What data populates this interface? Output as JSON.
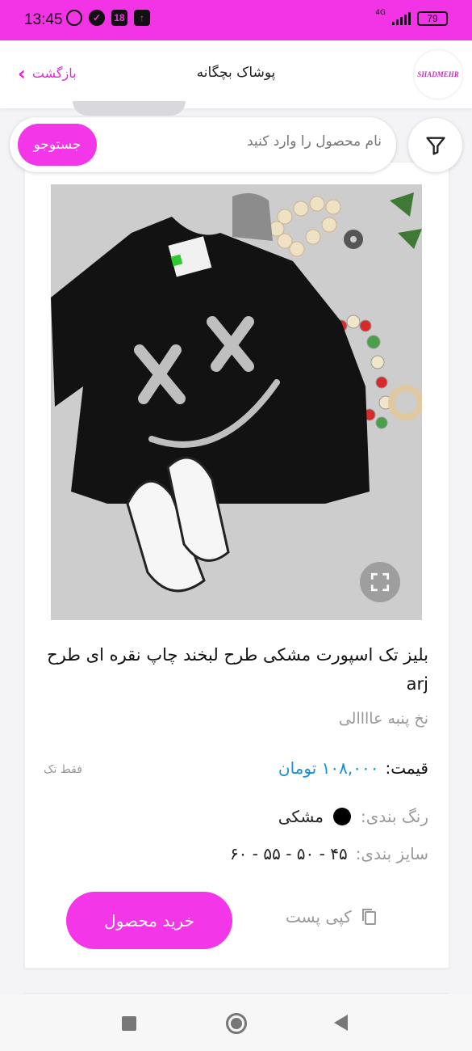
{
  "status_bar": {
    "time": "13:45",
    "badge_number": "18",
    "network": "4G",
    "battery": "79"
  },
  "header": {
    "logo_text": "SHADMEHR",
    "title": "پوشاک بچگانه",
    "back_label": "بازگشت"
  },
  "search": {
    "placeholder": "نام محصول را وارد کنید",
    "button_label": "جستوجو"
  },
  "product": {
    "title": "بلیز تک اسپورت مشکی طرح لبخند چاپ نقره ای طرح arj",
    "subtitle": "نخ پنبه عاااالی",
    "price_label": "قیمت:",
    "price_value": "۱۰۸,۰۰۰ تومان",
    "single_only": "فقط تک",
    "color_label": "رنگ بندی:",
    "color_value": "مشکی",
    "size_label": "سایز بندی:",
    "size_value": "۴۵ - ۵۰ - ۵۵ - ۶۰",
    "copy_label": "کپی پست",
    "buy_label": "خرید محصول"
  },
  "colors": {
    "accent": "#f236e8",
    "price": "#1a8fd1",
    "status_bar": "#f233e6"
  }
}
